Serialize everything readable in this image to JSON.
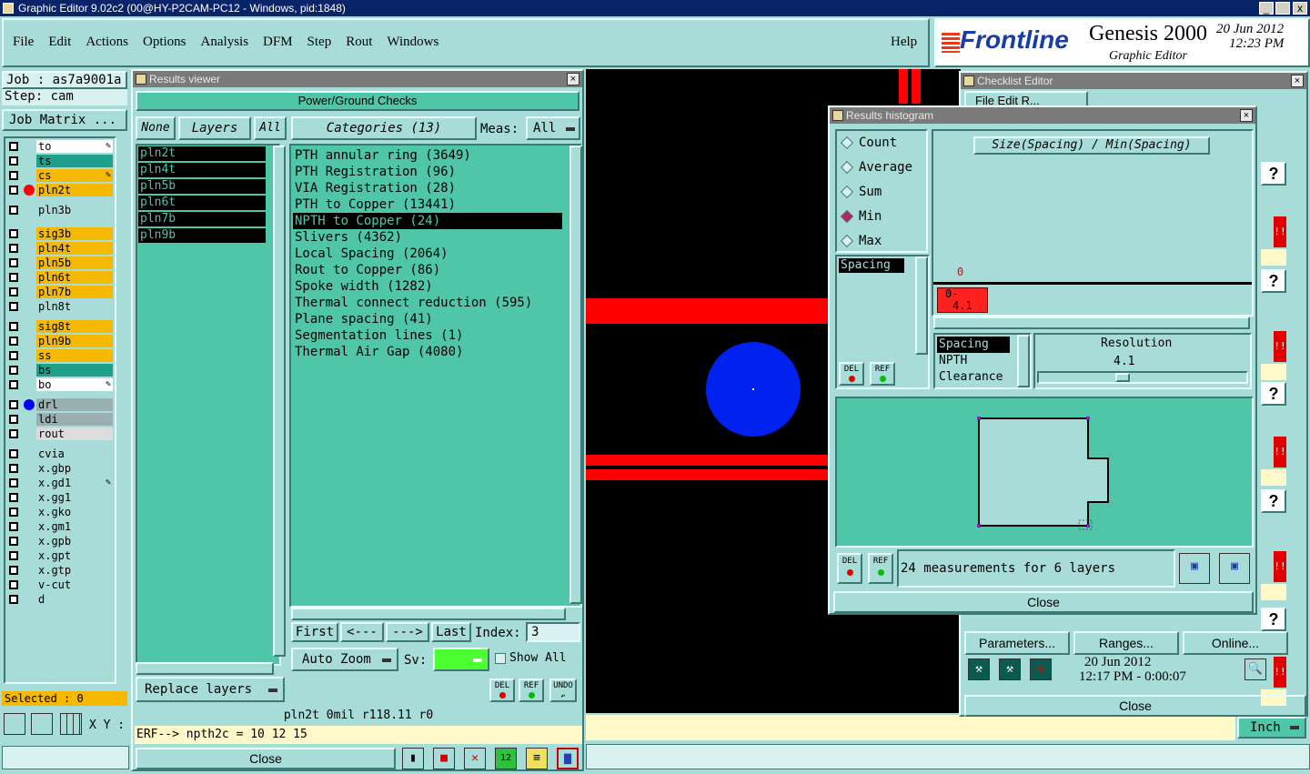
{
  "window_title": "Graphic Editor 9.02c2 (00@HY-P2CAM-PC12 - Windows, pid:1848)",
  "menu": [
    "File",
    "Edit",
    "Actions",
    "Options",
    "Analysis",
    "DFM",
    "Step",
    "Rout",
    "Windows"
  ],
  "help_label": "Help",
  "brand": {
    "logo": "Frontline",
    "product": "Genesis 2000",
    "subtitle": "Graphic Editor",
    "date": "20 Jun 2012",
    "time": "12:23 PM"
  },
  "job": {
    "job_label": "Job : as7a9001a",
    "step_label": "Step: cam",
    "matrix_btn": "Job Matrix ..."
  },
  "layers": [
    {
      "name": "to",
      "color": "#ffffff",
      "marker": "edit"
    },
    {
      "name": "ts",
      "color": "#1ea08a"
    },
    {
      "name": "cs",
      "color": "#f7b800",
      "marker": "edit"
    },
    {
      "name": "pln2t",
      "color": "#f7b800",
      "dot": "#ff0000"
    },
    {
      "name": "pln3b",
      "color": "#a8dcd8"
    },
    {
      "name": "sig3b",
      "color": "#f7b800"
    },
    {
      "name": "pln4t",
      "color": "#f7b800"
    },
    {
      "name": "pln5b",
      "color": "#f7b800"
    },
    {
      "name": "pln6t",
      "color": "#f7b800"
    },
    {
      "name": "pln7b",
      "color": "#f7b800"
    },
    {
      "name": "pln8t",
      "color": "#a8dcd8"
    },
    {
      "name": "sig8t",
      "color": "#f7b800"
    },
    {
      "name": "pln9b",
      "color": "#f7b800"
    },
    {
      "name": "ss",
      "color": "#f7b800"
    },
    {
      "name": "bs",
      "color": "#1ea08a"
    },
    {
      "name": "bo",
      "color": "#ffffff",
      "marker": "edit"
    },
    {
      "name": "drl",
      "color": "#9ab0b0",
      "dot": "#0000ff"
    },
    {
      "name": "ldi",
      "color": "#9ab0b0"
    },
    {
      "name": "rout",
      "color": "#dcdcdc"
    },
    {
      "name": "cvia",
      "color": "#a8dcd8"
    },
    {
      "name": "x.gbp",
      "color": "#a8dcd8"
    },
    {
      "name": "x.gd1",
      "color": "#a8dcd8",
      "marker": "edit"
    },
    {
      "name": "x.gg1",
      "color": "#a8dcd8"
    },
    {
      "name": "x.gko",
      "color": "#a8dcd8"
    },
    {
      "name": "x.gm1",
      "color": "#a8dcd8"
    },
    {
      "name": "x.gpb",
      "color": "#a8dcd8"
    },
    {
      "name": "x.gpt",
      "color": "#a8dcd8"
    },
    {
      "name": "x.gtp",
      "color": "#a8dcd8"
    },
    {
      "name": "v-cut",
      "color": "#a8dcd8"
    },
    {
      "name": "d",
      "color": "#a8dcd8"
    }
  ],
  "selected_label": "Selected : 0",
  "xy_label": "X Y :",
  "results_viewer": {
    "title": "Results viewer",
    "header": "Power/Ground Checks",
    "none_btn": "None",
    "layers_btn": "Layers",
    "all_btn": "All",
    "categories_btn": "Categories (13)",
    "meas_label": "Meas:",
    "meas_value": "All",
    "layer_list": [
      "pln2t",
      "pln4t",
      "pln5b",
      "pln6t",
      "pln7b",
      "pln9b"
    ],
    "categories": [
      "PTH annular ring (3649)",
      "PTH Registration (96)",
      "VIA Registration (28)",
      "PTH to Copper (13441)",
      "NPTH to Copper (24)",
      "Slivers (4362)",
      "Local Spacing (2064)",
      "Rout to Copper (86)",
      "Spoke width (1282)",
      "Thermal connect reduction (595)",
      "Plane spacing (41)",
      "Segmentation lines (1)",
      "Thermal Air Gap (4080)"
    ],
    "selected_category_index": 4,
    "first_btn": "First",
    "prev_btn": "<---",
    "next_btn": "--->",
    "last_btn": "Last",
    "index_label": "Index:",
    "index_value": "3",
    "autozoom_btn": "Auto Zoom",
    "sv_label": "Sv:",
    "show_all_label": "Show All",
    "replace_btn": "Replace layers",
    "del_label": "DEL",
    "ref_label": "REF",
    "undo_label": "UNDO",
    "status_line": "pln2t 0mil   r118.11   r0",
    "erf_line": "ERF--> npth2c = 10 12 15",
    "close_btn": "Close"
  },
  "histogram": {
    "title": "Results histogram",
    "radios": [
      "Count",
      "Average",
      "Sum",
      "Min",
      "Max"
    ],
    "selected_radio": "Min",
    "chart_title": "Size(Spacing) / Min(Spacing)",
    "bar_count": "0",
    "bar_label": "0-",
    "bar_value": "4.1",
    "attr_list": [
      "Spacing"
    ],
    "measure_list": [
      "Spacing",
      "NPTH",
      "Clearance"
    ],
    "resolution_label": "Resolution",
    "resolution_value": "4.1",
    "status": "24 measurements for 6 layers",
    "del_label": "DEL",
    "ref_label": "REF",
    "close_btn": "Close"
  },
  "checklist": {
    "title": "Checklist Editor",
    "menu_partial": "File  Edit  R...",
    "params_btn": "Parameters...",
    "ranges_btn": "Ranges...",
    "online_btn": "Online...",
    "date": "20 Jun 2012",
    "time": "12:17 PM - 0:00:07",
    "close_btn": "Close",
    "question": "?",
    "alert": "!!"
  },
  "units": "Inch",
  "colors": {
    "panel": "#a8dcd8",
    "green": "#4fc6a8",
    "layer_yellow": "#f7b800",
    "pad_red": "#ff0000",
    "pad_blue": "#0022ee"
  }
}
